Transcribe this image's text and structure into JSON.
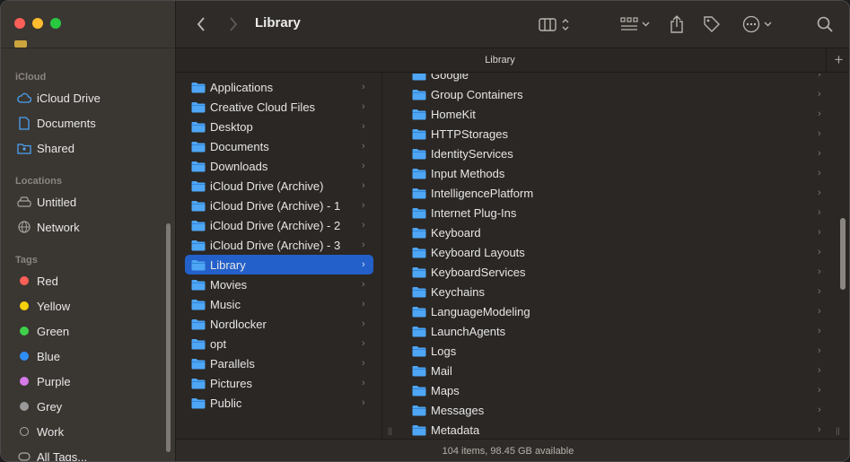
{
  "window": {
    "title": "Library",
    "path_tab": "Library"
  },
  "sidebar": {
    "sections": [
      {
        "label": "iCloud",
        "items": [
          {
            "label": "iCloud Drive",
            "icon": "cloud-icon"
          },
          {
            "label": "Documents",
            "icon": "document-icon"
          },
          {
            "label": "Shared",
            "icon": "shared-folder-icon"
          }
        ]
      },
      {
        "label": "Locations",
        "items": [
          {
            "label": "Untitled",
            "icon": "drive-icon"
          },
          {
            "label": "Network",
            "icon": "globe-icon"
          }
        ]
      },
      {
        "label": "Tags",
        "items": [
          {
            "label": "Red",
            "color": "#fe5f57"
          },
          {
            "label": "Yellow",
            "color": "#f5d20a"
          },
          {
            "label": "Green",
            "color": "#3ed04a"
          },
          {
            "label": "Blue",
            "color": "#2f8ef5"
          },
          {
            "label": "Purple",
            "color": "#d57ae8"
          },
          {
            "label": "Grey",
            "color": "#9a9a9a"
          },
          {
            "label": "Work",
            "color": "outline"
          },
          {
            "label": "All Tags...",
            "icon": "all-tags-icon"
          }
        ]
      }
    ]
  },
  "columns": {
    "first": [
      "Applications",
      "Creative Cloud Files",
      "Desktop",
      "Documents",
      "Downloads",
      "iCloud Drive (Archive)",
      "iCloud Drive (Archive) - 1",
      "iCloud Drive (Archive) - 2",
      "iCloud Drive (Archive) - 3",
      "Library",
      "Movies",
      "Music",
      "Nordlocker",
      "opt",
      "Parallels",
      "Pictures",
      "Public"
    ],
    "first_selected": "Library",
    "second": [
      "Google",
      "Group Containers",
      "HomeKit",
      "HTTPStorages",
      "IdentityServices",
      "Input Methods",
      "IntelligencePlatform",
      "Internet Plug-Ins",
      "Keyboard",
      "Keyboard Layouts",
      "KeyboardServices",
      "Keychains",
      "LanguageModeling",
      "LaunchAgents",
      "Logs",
      "Mail",
      "Maps",
      "Messages",
      "Metadata"
    ]
  },
  "status": {
    "text": "104 items, 98.45 GB available"
  },
  "colors": {
    "accent": "#2360c9",
    "folder": "#4ea6f5"
  }
}
